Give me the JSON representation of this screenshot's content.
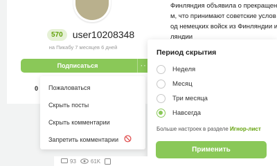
{
  "profile": {
    "rating": "570",
    "username": "user10208348",
    "meta": "на Пикабу 7 месяцев 6 дней",
    "subscribe_label": "Подписаться",
    "more_label": "···",
    "stat_value": "0",
    "stat_suffix": "п"
  },
  "article": {
    "lines": [
      "Финляндия объявила о прекращени",
      "м, что принимают советские услов",
      "од немецких войск из Финляндии и",
      "ляндии"
    ]
  },
  "menu": {
    "items": [
      {
        "label": "Пожаловаться"
      },
      {
        "label": "Скрыть посты"
      },
      {
        "label": "Скрыть комментарии"
      },
      {
        "label": "Запретить комментарии",
        "icon": "ban-icon"
      }
    ]
  },
  "hide_panel": {
    "title": "Период скрытия",
    "options": [
      {
        "label": "Неделя",
        "checked": false
      },
      {
        "label": "Месяц",
        "checked": false
      },
      {
        "label": "Три месяца",
        "checked": false
      },
      {
        "label": "Навсегда",
        "checked": true
      }
    ],
    "note_prefix": "Больше настроек в разделе",
    "note_link": "Игнор-лист",
    "apply_label": "Применить"
  },
  "bottom_stats": {
    "comments": "93",
    "views": "61K"
  },
  "colors": {
    "accent": "#8ac858",
    "accent_text": "#62a10a"
  }
}
